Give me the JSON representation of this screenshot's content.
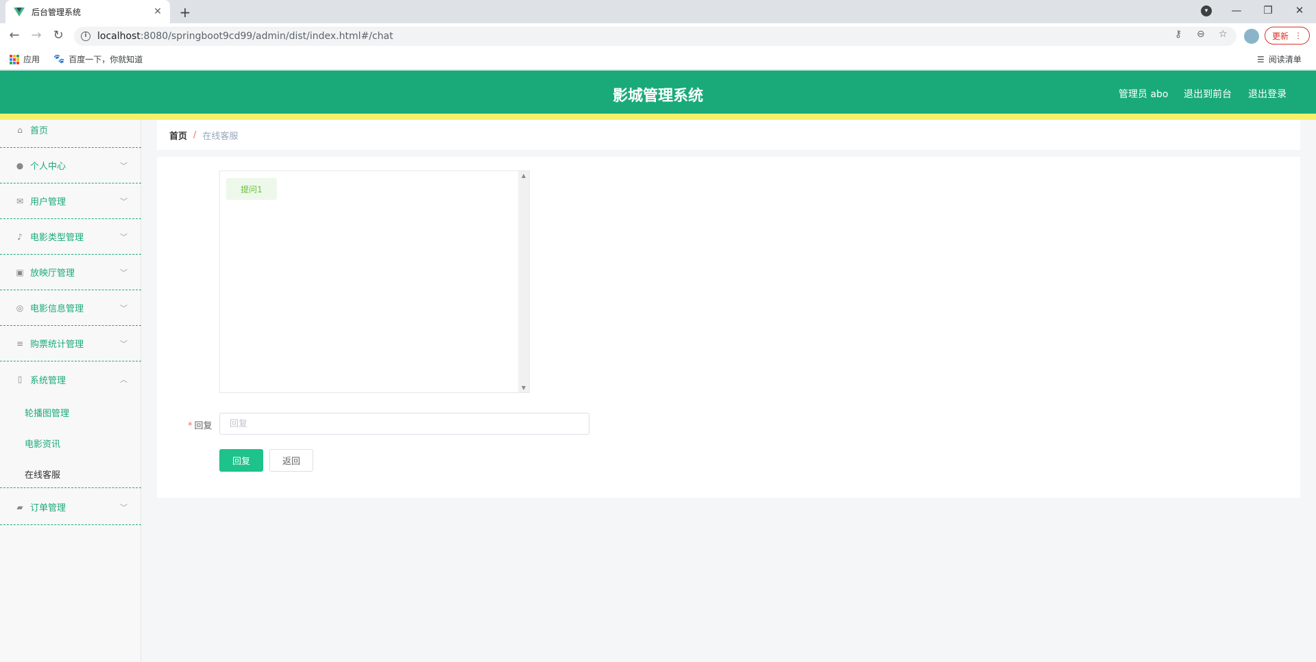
{
  "browser": {
    "tab_title": "后台管理系统",
    "url_host": "localhost",
    "url_rest": ":8080/springboot9cd99/admin/dist/index.html#/chat",
    "update_label": "更新",
    "bookmarks": [
      {
        "label": "应用",
        "icon": "apps-grid-icon"
      },
      {
        "label": "百度一下，你就知道",
        "icon": "baidu-paw-icon"
      }
    ],
    "reading_list": "阅读清单",
    "accent": "#d93025"
  },
  "header": {
    "title": "影城管理系统",
    "admin_label": "管理员 abo",
    "to_front": "退出到前台",
    "logout": "退出登录",
    "color": "#1aaa7a",
    "strip_color": "#f5f06a"
  },
  "sidebar": {
    "items": [
      {
        "label": "首页",
        "icon": "home-icon"
      },
      {
        "label": "个人中心",
        "icon": "user-icon"
      },
      {
        "label": "用户管理",
        "icon": "mail-icon"
      },
      {
        "label": "电影类型管理",
        "icon": "microphone-icon"
      },
      {
        "label": "放映厅管理",
        "icon": "clipboard-icon"
      },
      {
        "label": "电影信息管理",
        "icon": "compass-icon"
      },
      {
        "label": "购票统计管理",
        "icon": "sliders-icon"
      },
      {
        "label": "系统管理",
        "icon": "phone-icon"
      },
      {
        "label": "订单管理",
        "icon": "wallet-icon"
      }
    ],
    "sub_items": [
      {
        "label": "轮播图管理"
      },
      {
        "label": "电影资讯"
      },
      {
        "label": "在线客服"
      }
    ]
  },
  "breadcrumb": {
    "home": "首页",
    "separator": "/",
    "current": "在线客服"
  },
  "chat": {
    "messages": [
      {
        "text": "提问1"
      }
    ]
  },
  "form": {
    "reply_label": "回复",
    "reply_placeholder": "回复",
    "reply_button": "回复",
    "back_button": "返回"
  }
}
